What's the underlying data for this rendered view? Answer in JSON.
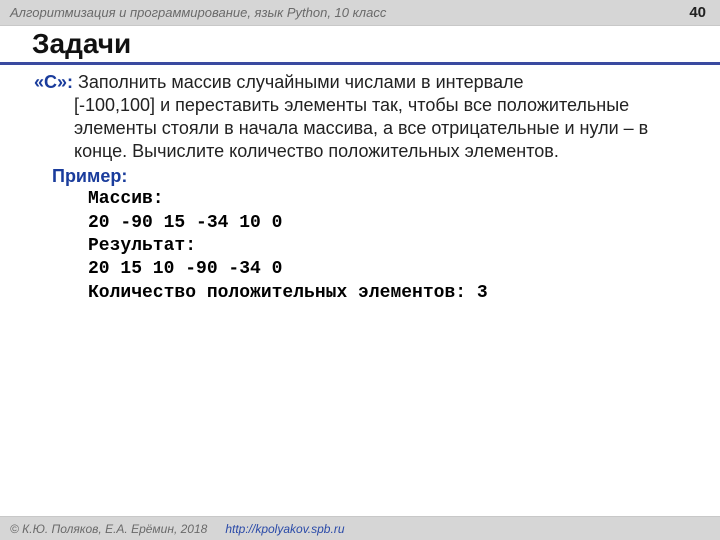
{
  "header": {
    "course": "Алгоритмизация и программирование, язык ",
    "lang": "Python",
    "grade": ", 10 класс",
    "page": "40"
  },
  "title": "Задачи",
  "task": {
    "label": "«С»:",
    "text_line1": " Заполнить массив случайными числами в интервале",
    "text_rest": "[-100,100] и переставить элементы так, чтобы все положительные элементы стояли в начала массива, а все отрицательные и нули – в конце.  Вычислите количество положительных элементов."
  },
  "example": {
    "label": "Пример:",
    "lines": {
      "l1": "Массив:",
      "l2": "20 -90 15 -34 10 0",
      "l3": "Результат:",
      "l4": "20 15 10 -90 -34 0",
      "l5": "Количество положительных элементов: 3"
    }
  },
  "footer": {
    "copyright": "© К.Ю. Поляков, Е.А. Ерёмин, 2018",
    "url": "http://kpolyakov.spb.ru"
  }
}
